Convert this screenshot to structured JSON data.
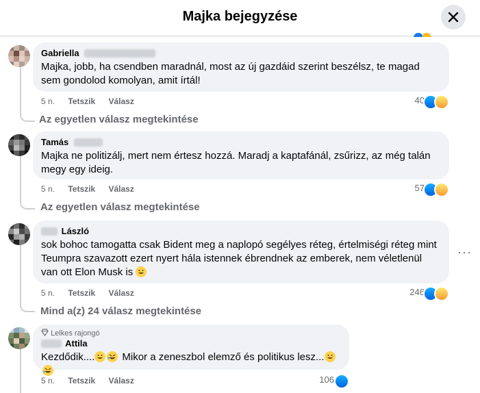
{
  "header": {
    "title": "Majka bejegyzése"
  },
  "comments": [
    {
      "author": "Gabriella",
      "text": "Majka, jobb, ha csendben maradnál, most az új gazdáid szerint beszélsz, te magad sem gondolod komolyan, amit írtál!",
      "time": "5 n.",
      "like_label": "Tetszik",
      "reply_label": "Válasz",
      "reaction_count": "40",
      "reactions": [
        "like-icon",
        "haha-icon"
      ]
    },
    {
      "author": "Tamás",
      "text": "Majka ne politizálj, mert nem értesz hozzá. Maradj a kaptafánál, zsűrizz, az még talán megy egy ideig.",
      "time": "5 n.",
      "like_label": "Tetszik",
      "reply_label": "Válasz",
      "reaction_count": "57",
      "reactions": [
        "like-icon",
        "haha-icon"
      ]
    },
    {
      "author": "László",
      "text": "sok bohoc tamogatta csak Bident meg a naplopó segélyes réteg, értelmiségi réteg mint Teumpra szavazott ezert nyert hála istennek ébrendnek az emberek, nem véletlenül van ott Elon Musk is",
      "time": "5 n.",
      "like_label": "Tetszik",
      "reply_label": "Válasz",
      "reaction_count": "246",
      "reactions": [
        "like-icon",
        "haha-icon"
      ],
      "more": "···"
    },
    {
      "badge": "Lelkes rajongó",
      "author": "Attila",
      "text_a": "Kezdődik....",
      "text_b": "Mikor a zeneszbol elemző és politikus lesz...",
      "time": "5 n.",
      "like_label": "Tetszik",
      "reply_label": "Válasz",
      "reaction_count": "106",
      "reactions": [
        "like-icon"
      ]
    }
  ],
  "view_replies": [
    "Az egyetlen válasz megtekintése",
    "Az egyetlen válasz megtekintése",
    "Mind a(z) 24 válasz megtekintése"
  ],
  "colors": {
    "bubble": "#f0f2f5",
    "secondary_text": "#65676b",
    "like_blue": "#0866ff",
    "haha_yellow": "#f7b928"
  }
}
